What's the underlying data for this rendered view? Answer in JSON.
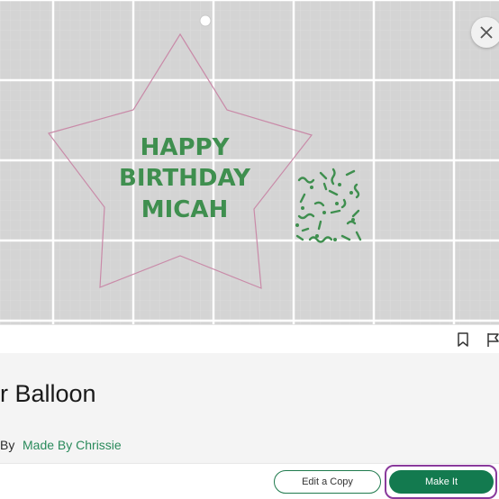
{
  "canvas": {
    "design_text": [
      "HAPPY",
      "BIRTHDAY",
      "MICAH"
    ],
    "background_color": "#d4d4d4",
    "grid_color": "#ffffff",
    "star_outline_color": "#c98aa8",
    "design_color": "#3f8f4f",
    "close_icon": "close-icon"
  },
  "toolbar": {
    "bookmark_icon": "bookmark-icon",
    "flag_icon": "flag-icon"
  },
  "project": {
    "title": "r Balloon",
    "by_label": "By",
    "author": "Made By Chrissie"
  },
  "actions": {
    "edit_copy_label": "Edit a Copy",
    "make_it_label": "Make It",
    "primary_color": "#137a4f",
    "highlight_color": "#8a3a9c"
  }
}
